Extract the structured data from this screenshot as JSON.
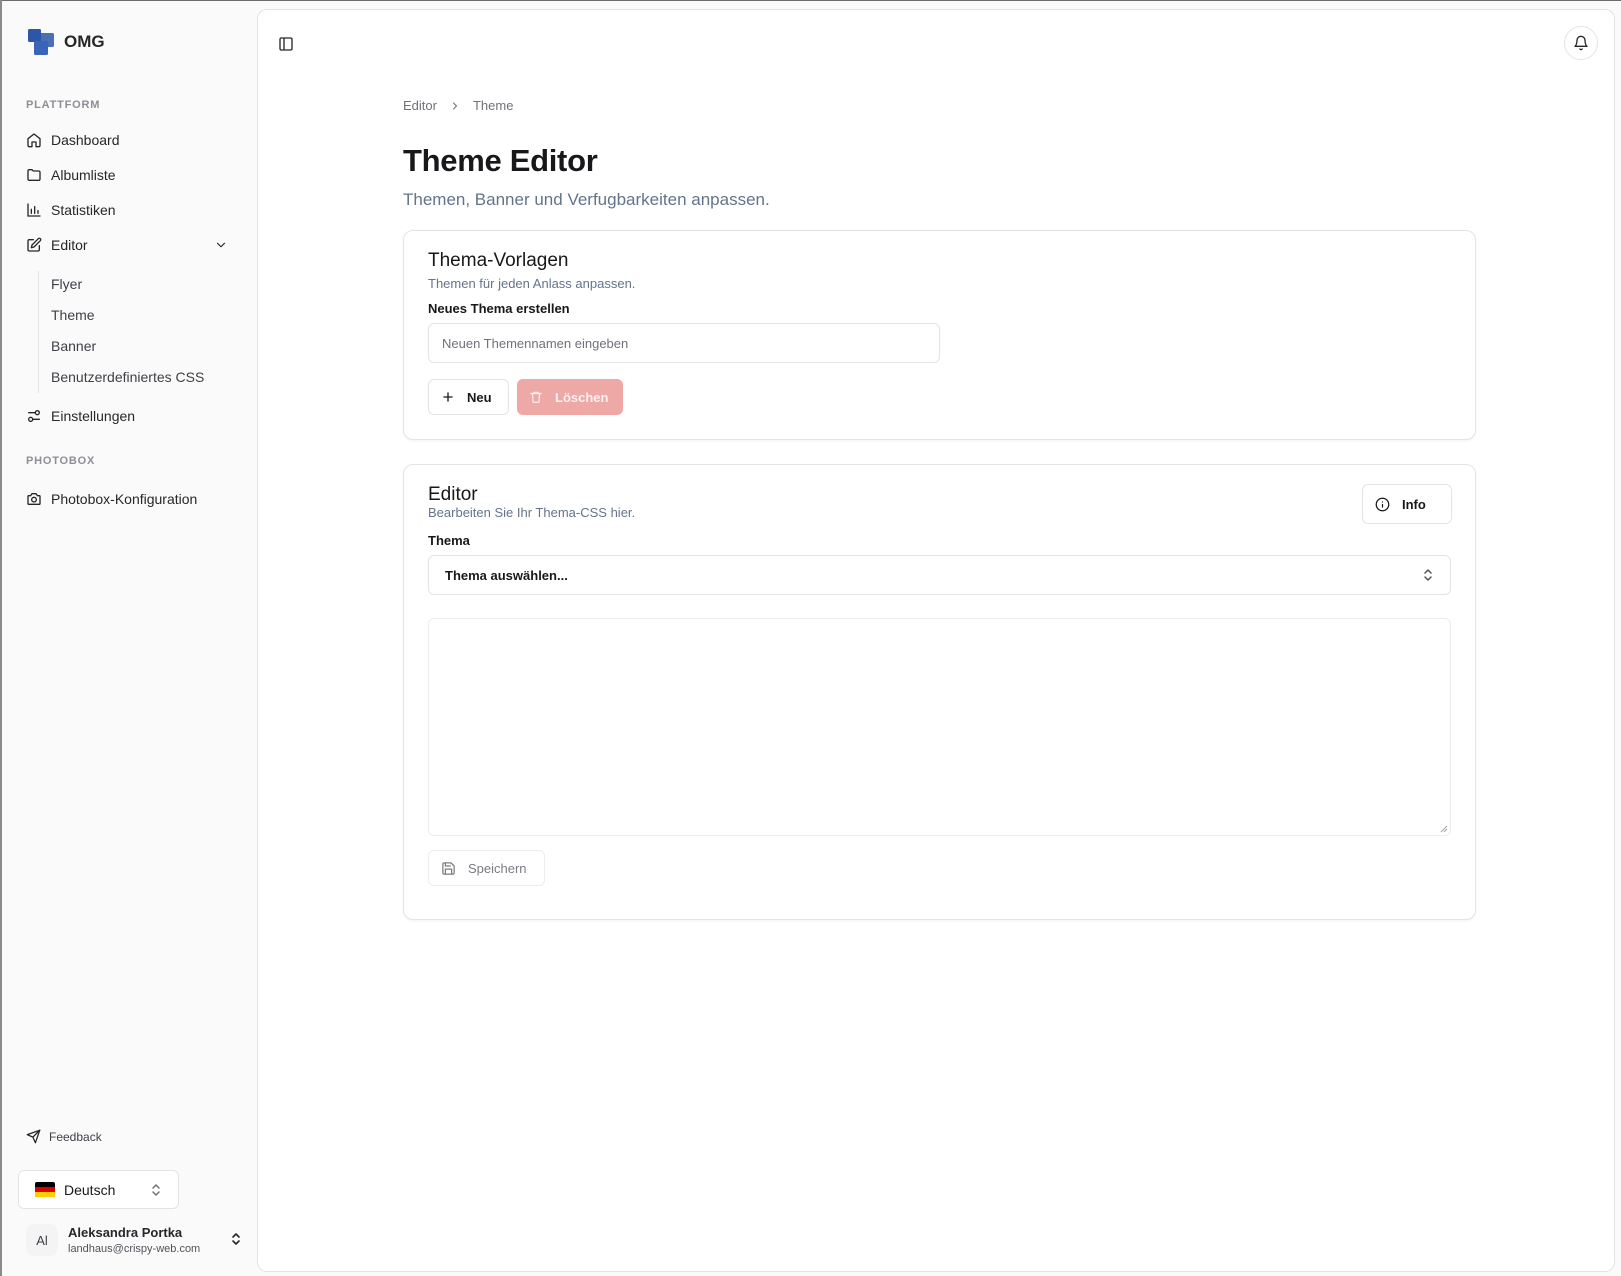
{
  "app": {
    "name": "OMG"
  },
  "colors": {
    "brand": "#2d56a6",
    "danger": "#eea8a6"
  },
  "sidebar": {
    "section_platform": "PLATTFORM",
    "items": [
      {
        "label": "Dashboard",
        "icon": "home-icon"
      },
      {
        "label": "Albumliste",
        "icon": "folder-icon"
      },
      {
        "label": "Statistiken",
        "icon": "bar-chart-icon"
      },
      {
        "label": "Editor",
        "icon": "edit-icon"
      }
    ],
    "editor_sub": [
      "Flyer",
      "Theme",
      "Banner",
      "Benutzerdefiniertes CSS"
    ],
    "settings_label": "Einstellungen",
    "section_photobox": "PHOTOBOX",
    "photobox_label": "Photobox-Konfiguration",
    "feedback_label": "Feedback",
    "language": "Deutsch",
    "user": {
      "initials": "Al",
      "name": "Aleksandra Portka",
      "email": "landhaus@crispy-web.com"
    }
  },
  "breadcrumb": {
    "parent": "Editor",
    "current": "Theme"
  },
  "page": {
    "title": "Theme Editor",
    "subtitle": "Themen, Banner und Verfugbarkeiten anpassen."
  },
  "templates_card": {
    "title": "Thema-Vorlagen",
    "description": "Themen für jeden Anlass anpassen.",
    "new_theme_label": "Neues Thema erstellen",
    "new_theme_placeholder": "Neuen Themennamen eingeben",
    "new_button": "Neu",
    "delete_button": "Löschen"
  },
  "editor_card": {
    "title": "Editor",
    "description": "Bearbeiten Sie Ihr Thema-CSS hier.",
    "info_button": "Info",
    "theme_label": "Thema",
    "theme_select_value": "Thema auswählen...",
    "css_content": "",
    "save_button": "Speichern"
  }
}
